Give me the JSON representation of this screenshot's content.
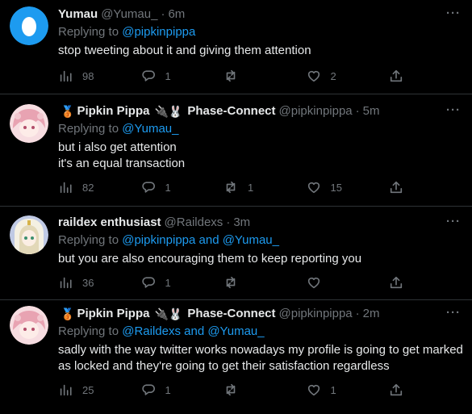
{
  "tweets": [
    {
      "name": "Yumau",
      "badges": [],
      "handle": "@Yumau_",
      "time": "6m",
      "reply_prefix": "Replying to ",
      "reply_to": "@pipkinpippa",
      "lines": [
        "stop tweeting about it and giving them attention"
      ],
      "views": "98",
      "replies": "1",
      "retweets": "",
      "likes": "2",
      "avatar": {
        "bg": "#1d9bf0",
        "fg": "#ffffff",
        "shape": "egg"
      }
    },
    {
      "name": "Pipkin Pippa",
      "badges": [
        "🥉"
      ],
      "after_name": "🔌🐰",
      "name2": "Phase-Connect",
      "handle": "@pipkinpippa",
      "time": "5m",
      "reply_prefix": "Replying to ",
      "reply_to": "@Yumau_",
      "lines": [
        "but i also get attention",
        "it's an equal transaction"
      ],
      "views": "82",
      "replies": "1",
      "retweets": "1",
      "likes": "15",
      "avatar": {
        "bg": "#f6d2d8",
        "fg": "#e79aa8",
        "shape": "girl"
      }
    },
    {
      "name": "raildex enthusiast",
      "handle": "@Raildexs",
      "time": "3m",
      "reply_prefix": "Replying to ",
      "reply_to": "@pipkinpippa and @Yumau_",
      "lines": [
        "but you are also encouraging them to keep reporting you"
      ],
      "views": "36",
      "replies": "1",
      "retweets": "",
      "likes": "",
      "avatar": {
        "bg": "#cfd6e8",
        "fg": "#f5f1e0",
        "shape": "nun"
      }
    },
    {
      "name": "Pipkin Pippa",
      "badges": [
        "🥉"
      ],
      "after_name": "🔌🐰",
      "name2": "Phase-Connect",
      "handle": "@pipkinpippa",
      "time": "2m",
      "reply_prefix": "Replying to ",
      "reply_to": "@Raildexs and @Yumau_",
      "lines": [
        "sadly with the way twitter works nowadays my profile is going to get marked",
        "as locked and they're going to get their satisfaction regardless"
      ],
      "views": "25",
      "replies": "1",
      "retweets": "",
      "likes": "1",
      "avatar": {
        "bg": "#f6d2d8",
        "fg": "#e79aa8",
        "shape": "girl"
      }
    }
  ],
  "more_label": "···",
  "colors": {
    "bg": "#000000",
    "text": "#e7e9ea",
    "muted": "#71767b",
    "link": "#1d9bf0",
    "divider": "#2f3336"
  }
}
